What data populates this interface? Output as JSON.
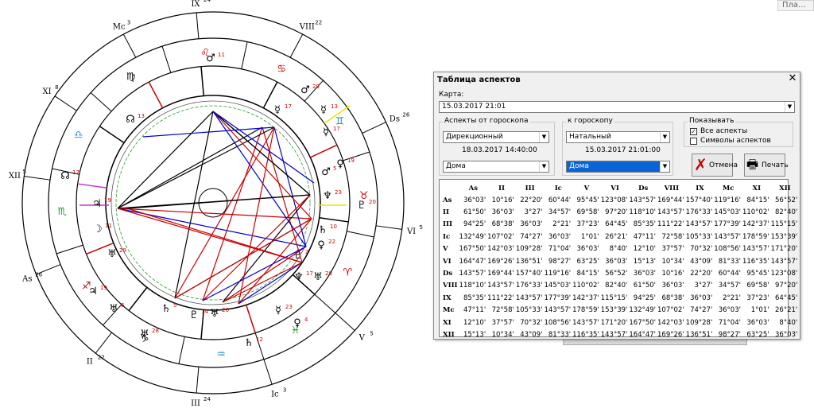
{
  "top_button": "Пла...",
  "chart": {
    "outer_labels": [
      {
        "t": "IX",
        "s": "24"
      },
      {
        "t": "VIII",
        "s": "22"
      },
      {
        "t": "Ds",
        "s": "26"
      },
      {
        "t": "VI",
        "s": "5"
      },
      {
        "t": "V",
        "s": "5"
      },
      {
        "t": "Ic",
        "s": "3"
      },
      {
        "t": "III",
        "s": "24"
      },
      {
        "t": "II",
        "s": "22"
      },
      {
        "t": "As",
        "s": "26"
      },
      {
        "t": "XII",
        "s": "5"
      },
      {
        "t": "XI",
        "s": "8"
      },
      {
        "t": "Mc",
        "s": "3"
      }
    ],
    "signs": [
      "♋",
      "♊",
      "♉",
      "♈",
      "♓",
      "♒",
      "♑",
      "♐",
      "♏",
      "♎",
      "♍",
      "♌"
    ],
    "planet_glyphs": [
      "♂",
      "☿",
      "♀",
      "♃",
      "♄",
      "♅",
      "♆",
      "♇",
      "☽",
      "☊"
    ],
    "planet_degrees": [
      "19",
      "11",
      "29",
      "13",
      "17",
      "19",
      "5",
      "23",
      "20",
      "10",
      "22",
      "2",
      "17",
      "28",
      "23",
      "4",
      "12",
      "26",
      "14",
      "5",
      "6",
      "28"
    ]
  },
  "dialog": {
    "title": "Таблица аспектов",
    "close": "✕",
    "map_label": "Карта:",
    "map_value": "15.03.2017 21:01",
    "from_group": "Аспекты от гороскопа",
    "from_type": "Дирекционный",
    "from_date": "18.03.2017 14:40:00",
    "from_mode": "Дома",
    "to_group": "к гороскопу",
    "to_type": "Натальный",
    "to_date": "15.03.2017 21:01:00",
    "to_mode": "Дома",
    "show_group": "Показывать",
    "opt_all": "Все аспекты",
    "opt_symbols": "Символы аспектов",
    "cancel": "Отмена",
    "print": "Печать",
    "columns": [
      "As",
      "II",
      "III",
      "Ic",
      "V",
      "VI",
      "Ds",
      "VIII",
      "IX",
      "Mc",
      "XI",
      "XII"
    ],
    "rows": [
      {
        "h": "As",
        "v": [
          "36°03'",
          "10°16'",
          "22°20'",
          "60°44'",
          "95°45'",
          "123°08'",
          "143°57'",
          "169°44'",
          "157°40'",
          "119°16'",
          "84°15'",
          "56°52'"
        ]
      },
      {
        "h": "II",
        "v": [
          "61°50'",
          "36°03'",
          "3°27'",
          "34°57'",
          "69°58'",
          "97°20'",
          "118°10'",
          "143°57'",
          "176°33'",
          "145°03'",
          "110°02'",
          "82°40'"
        ]
      },
      {
        "h": "III",
        "v": [
          "94°25'",
          "68°38'",
          "36°03'",
          "2°21'",
          "37°23'",
          "64°45'",
          "85°35'",
          "111°22'",
          "143°57'",
          "177°39'",
          "142°37'",
          "115°15'"
        ]
      },
      {
        "h": "Ic",
        "v": [
          "132°49'",
          "107°02'",
          "74°27'",
          "36°03'",
          "1°01'",
          "26°21'",
          "47°11'",
          "72°58'",
          "105°33'",
          "143°57'",
          "178°59'",
          "153°39'"
        ]
      },
      {
        "h": "V",
        "v": [
          "167°50'",
          "142°03'",
          "109°28'",
          "71°04'",
          "36°03'",
          "8°40'",
          "12°10'",
          "37°57'",
          "70°32'",
          "108°56'",
          "143°57'",
          "171°20'"
        ]
      },
      {
        "h": "VI",
        "v": [
          "164°47'",
          "169°26'",
          "136°51'",
          "98°27'",
          "63°25'",
          "36°03'",
          "15°13'",
          "10°34'",
          "43°09'",
          "81°33'",
          "116°35'",
          "143°57'"
        ]
      },
      {
        "h": "Ds",
        "v": [
          "143°57'",
          "169°44'",
          "157°40'",
          "119°16'",
          "84°15'",
          "56°52'",
          "36°03'",
          "10°16'",
          "22°20'",
          "60°44'",
          "95°45'",
          "123°08'"
        ]
      },
      {
        "h": "VIII",
        "v": [
          "118°10'",
          "143°57'",
          "176°33'",
          "145°03'",
          "110°02'",
          "82°40'",
          "61°50'",
          "36°03'",
          "3°27'",
          "34°57'",
          "69°58'",
          "97°20'"
        ]
      },
      {
        "h": "IX",
        "v": [
          "85°35'",
          "111°22'",
          "143°57'",
          "177°39'",
          "142°37'",
          "115°15'",
          "94°25'",
          "68°38'",
          "36°03'",
          "2°21'",
          "37°23'",
          "64°45'"
        ]
      },
      {
        "h": "Mc",
        "v": [
          "47°11'",
          "72°58'",
          "105°33'",
          "143°57'",
          "178°59'",
          "153°39'",
          "132°49'",
          "107°02'",
          "74°27'",
          "36°03'",
          "1°01'",
          "26°21'"
        ]
      },
      {
        "h": "XI",
        "v": [
          "12°10'",
          "37°57'",
          "70°32'",
          "108°56'",
          "143°57'",
          "171°20'",
          "167°50'",
          "142°03'",
          "109°28'",
          "71°04'",
          "36°03'",
          "8°40'"
        ]
      },
      {
        "h": "XII",
        "v": [
          "15°13'",
          "10°34'",
          "43°09'",
          "81°33'",
          "116°35'",
          "143°57'",
          "164°47'",
          "169°26'",
          "136°51'",
          "98°27'",
          "63°25'",
          "36°03'"
        ]
      }
    ]
  }
}
